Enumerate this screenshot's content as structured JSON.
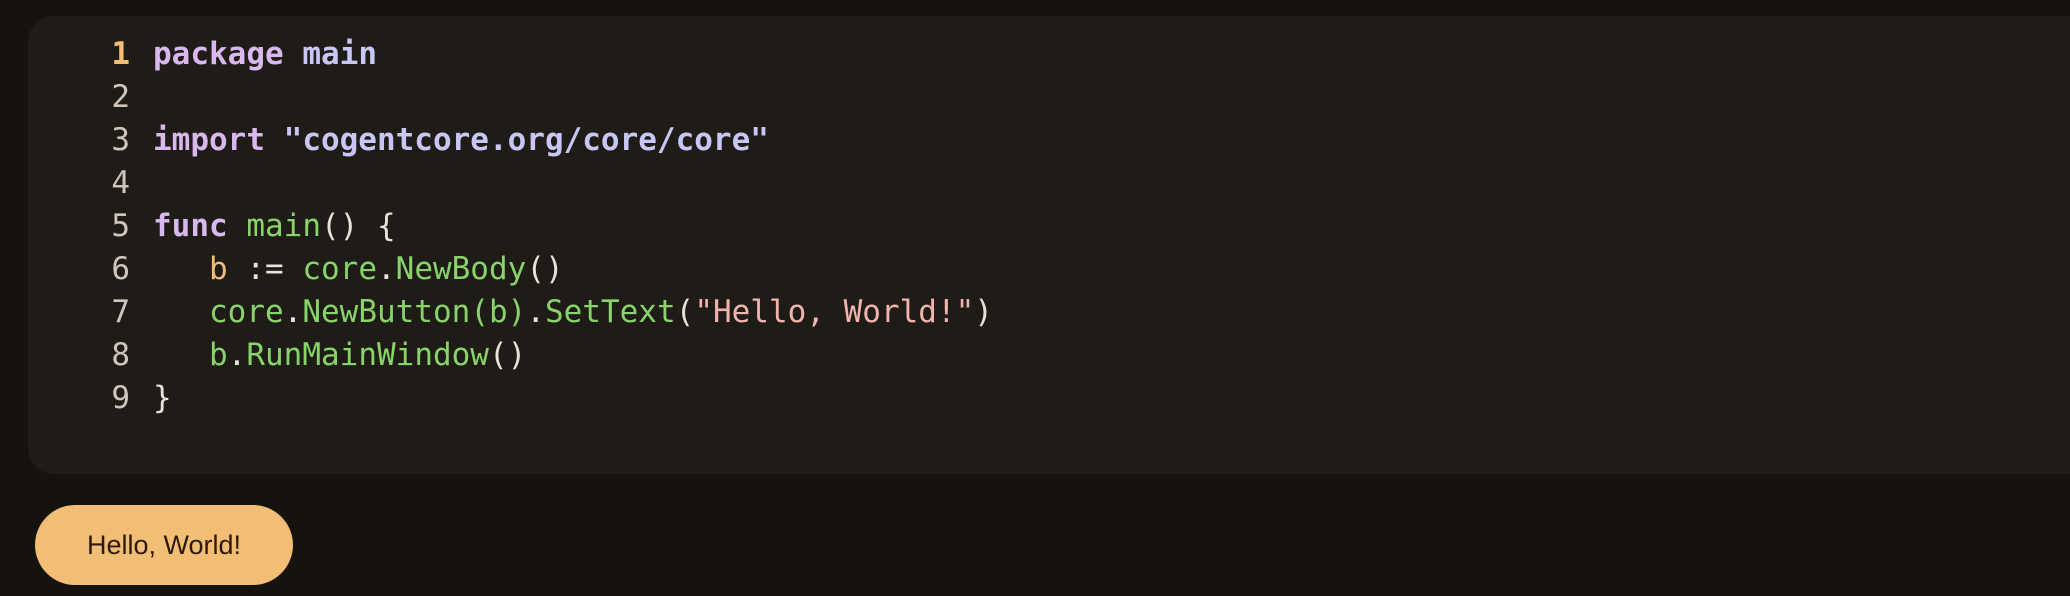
{
  "editor": {
    "line_numbers": [
      "1",
      "2",
      "3",
      "4",
      "5",
      "6",
      "7",
      "8",
      "9"
    ],
    "active_line": "1",
    "lines": [
      [
        {
          "t": "package",
          "c": "kw"
        },
        {
          "t": " ",
          "c": "punct"
        },
        {
          "t": "main",
          "c": "pkg"
        }
      ],
      [],
      [
        {
          "t": "import",
          "c": "kw"
        },
        {
          "t": " ",
          "c": "punct"
        },
        {
          "t": "\"cogentcore.org/core/core\"",
          "c": "str-import"
        }
      ],
      [],
      [
        {
          "t": "func",
          "c": "kw"
        },
        {
          "t": " ",
          "c": "punct"
        },
        {
          "t": "main",
          "c": "fn"
        },
        {
          "t": "() {",
          "c": "punct"
        }
      ],
      [
        {
          "t": "   ",
          "c": "punct"
        },
        {
          "t": "b",
          "c": "var"
        },
        {
          "t": " := ",
          "c": "punct"
        },
        {
          "t": "core",
          "c": "fn"
        },
        {
          "t": ".",
          "c": "punct"
        },
        {
          "t": "NewBody",
          "c": "fn"
        },
        {
          "t": "()",
          "c": "punct"
        }
      ],
      [
        {
          "t": "   ",
          "c": "punct"
        },
        {
          "t": "core",
          "c": "fn"
        },
        {
          "t": ".",
          "c": "punct"
        },
        {
          "t": "NewButton",
          "c": "fn"
        },
        {
          "t": "(b)",
          "c": "fn"
        },
        {
          "t": ".",
          "c": "punct"
        },
        {
          "t": "SetText",
          "c": "fn"
        },
        {
          "t": "(",
          "c": "punct"
        },
        {
          "t": "\"Hello, World!\"",
          "c": "str"
        },
        {
          "t": ")",
          "c": "punct"
        }
      ],
      [
        {
          "t": "   ",
          "c": "punct"
        },
        {
          "t": "b",
          "c": "fn"
        },
        {
          "t": ".",
          "c": "punct"
        },
        {
          "t": "RunMainWindow",
          "c": "fn"
        },
        {
          "t": "()",
          "c": "punct"
        }
      ],
      [
        {
          "t": "}",
          "c": "punct"
        }
      ]
    ]
  },
  "output": {
    "button_label": "Hello, World!"
  },
  "colors": {
    "background": "#16130f",
    "panel": "#1f1c18",
    "accent": "#f2bd74",
    "keyword": "#d9b8f0",
    "function": "#88d36a",
    "string": "#f0b4ad"
  }
}
